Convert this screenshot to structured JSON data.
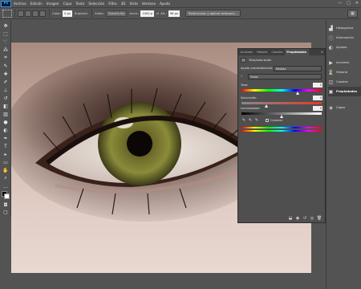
{
  "app": {
    "logo": "Ps"
  },
  "menu": [
    "Archivo",
    "Edición",
    "Imagen",
    "Capa",
    "Texto",
    "Selección",
    "Filtro",
    "3D",
    "Vista",
    "Ventana",
    "Ayuda"
  ],
  "window_controls": [
    "—",
    "□",
    "✕"
  ],
  "options_bar": {
    "feather_label": "Calar:",
    "feather_value": "0 px",
    "antialias_label": "Suavizar",
    "style_label": "Estilo:",
    "style_value": "Tamaño fijo",
    "width_label": "Anch.:",
    "width_value": "1000 p",
    "height_label": "Alt.:",
    "height_value": "96 px",
    "refine_button": "Seleccionar y aplicar máscara..."
  },
  "dock": {
    "items": [
      {
        "label": "Histograma",
        "icon": "histogram-icon",
        "glyph": "▟"
      },
      {
        "label": "Información",
        "icon": "info-icon",
        "glyph": "ⓘ"
      },
      {
        "label": "Ajustes",
        "icon": "adjustments-icon",
        "glyph": "◐"
      },
      {
        "label": "Acciones",
        "icon": "actions-icon",
        "glyph": "▶"
      },
      {
        "label": "Historia",
        "icon": "history-icon",
        "glyph": "⌛"
      },
      {
        "label": "Canales",
        "icon": "channels-icon",
        "glyph": "◫"
      },
      {
        "label": "Propiedades",
        "icon": "properties-icon",
        "glyph": "▣"
      },
      {
        "label": "Capas",
        "icon": "layers-icon",
        "glyph": "◈"
      }
    ],
    "active_index": 6
  },
  "properties": {
    "tabs": [
      "Acciones",
      "Historia",
      "Canales",
      "Propiedades"
    ],
    "active_tab": "Propiedades",
    "heading": "Tono/saturación",
    "preset_label": "Ajuste preestablecido:",
    "preset_value": "Medida",
    "channel_value": "Todos",
    "hue_label": "Tono:",
    "hue_value": "0",
    "saturation_label": "Saturación:",
    "saturation_value": "0",
    "lightness_label": "Luminosidad:",
    "lightness_value": "0",
    "colorize_label": "Colorear"
  },
  "colors": {
    "background": "#535353",
    "panel": "#4f4f4f",
    "accent": "#2f9cf8"
  }
}
